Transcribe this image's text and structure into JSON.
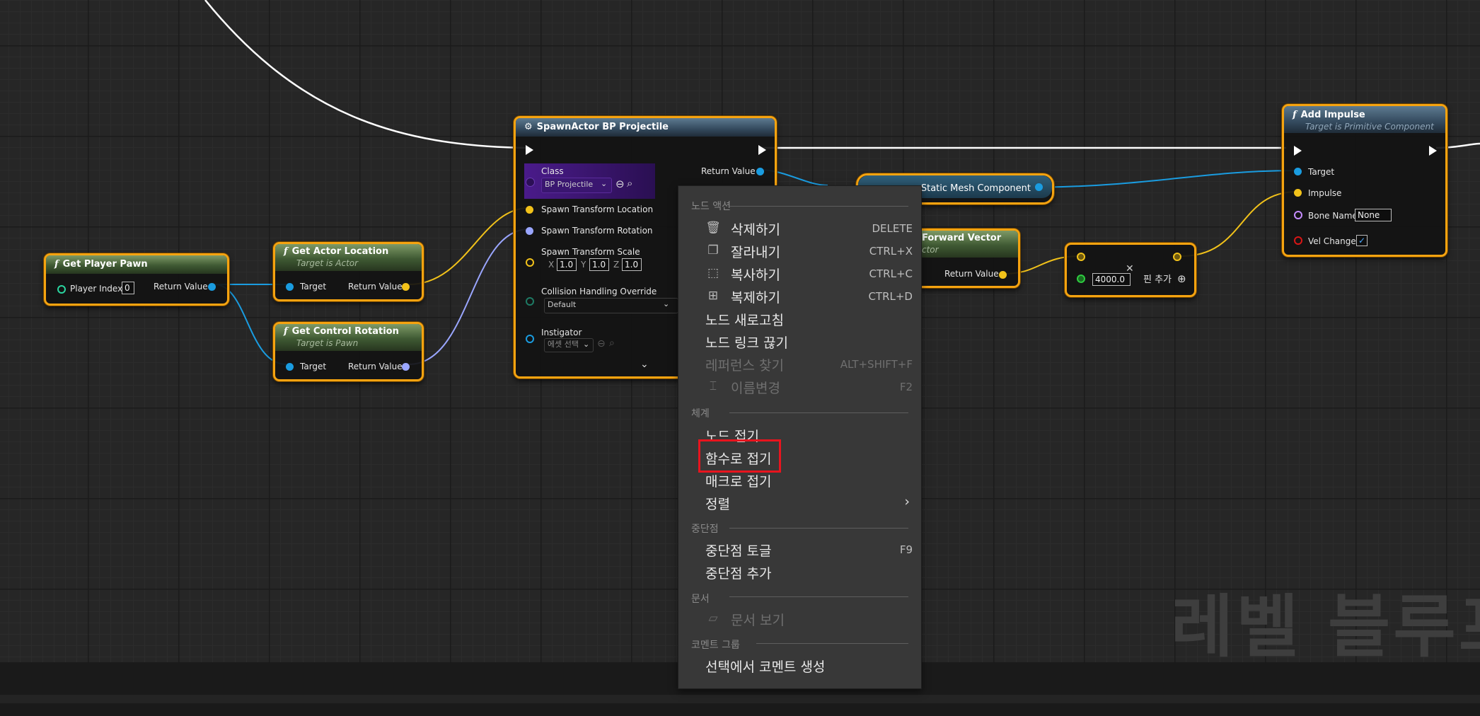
{
  "colors": {
    "node_border": "#f5a310",
    "pin_object": "#1a9ce0",
    "pin_vector": "#f2c21a",
    "pin_rotator": "#9aa6ff",
    "highlight": "#e8141e"
  },
  "nodes": {
    "get_player_pawn": {
      "title": "Get Player Pawn",
      "player_index_label": "Player Index",
      "player_index_value": "0",
      "return_label": "Return Value"
    },
    "get_actor_location": {
      "title": "Get Actor Location",
      "subtitle": "Target is Actor",
      "target_label": "Target",
      "return_label": "Return Value"
    },
    "get_control_rotation": {
      "title": "Get Control Rotation",
      "subtitle": "Target is Pawn",
      "target_label": "Target",
      "return_label": "Return Value"
    },
    "spawn_actor": {
      "title": "SpawnActor BP Projectile",
      "class_label": "Class",
      "class_value": "BP Projectile",
      "return_label": "Return Value",
      "loc_label": "Spawn Transform Location",
      "rot_label": "Spawn Transform Rotation",
      "scale_label": "Spawn Transform Scale",
      "scale_x_label": "X",
      "scale_x": "1.0",
      "scale_y_label": "Y",
      "scale_y": "1.0",
      "scale_z_label": "Z",
      "scale_z": "1.0",
      "collision_label": "Collision Handling Override",
      "collision_value": "Default",
      "instigator_label": "Instigator",
      "instigator_value": "에셋 선택"
    },
    "static_mesh": {
      "title": "Static Mesh Component"
    },
    "forward_vector": {
      "title": "Forward Vector",
      "subtitle": "ctor",
      "return_label": "Return Value"
    },
    "multiply": {
      "value": "4000.0",
      "add_pin_label": "핀 추가"
    },
    "add_impulse": {
      "title": "Add Impulse",
      "subtitle": "Target is Primitive Component",
      "target_label": "Target",
      "impulse_label": "Impulse",
      "bone_label": "Bone Name",
      "bone_value": "None",
      "vel_label": "Vel Change"
    }
  },
  "context_menu": {
    "section_node_actions": "노드 액션",
    "delete": {
      "label": "삭제하기",
      "shortcut": "DELETE"
    },
    "cut": {
      "label": "잘라내기",
      "shortcut": "CTRL+X"
    },
    "copy": {
      "label": "복사하기",
      "shortcut": "CTRL+C"
    },
    "duplicate": {
      "label": "복제하기",
      "shortcut": "CTRL+D"
    },
    "refresh": {
      "label": "노드 새로고침"
    },
    "break_links": {
      "label": "노드 링크 끊기"
    },
    "find_refs": {
      "label": "레퍼런스 찾기",
      "shortcut": "ALT+SHIFT+F"
    },
    "rename": {
      "label": "이름변경",
      "shortcut": "F2"
    },
    "section_organization": "체계",
    "collapse_nodes": {
      "label": "노드 접기"
    },
    "collapse_function": {
      "label": "함수로 접기"
    },
    "collapse_macro": {
      "label": "매크로 접기"
    },
    "align": {
      "label": "정렬"
    },
    "section_breakpoints": "중단점",
    "toggle_breakpoint": {
      "label": "중단점 토글",
      "shortcut": "F9"
    },
    "add_breakpoint": {
      "label": "중단점 추가"
    },
    "section_documentation": "문서",
    "view_docs": {
      "label": "문서 보기"
    },
    "section_comment_group": "코멘트 그룹",
    "create_comment": {
      "label": "선택에서 코멘트 생성"
    }
  },
  "watermark": "레벨 블루프"
}
